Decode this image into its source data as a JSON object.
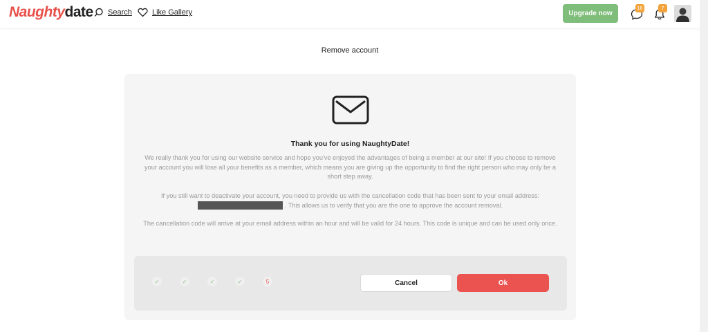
{
  "header": {
    "logo_part1": "Naughty",
    "logo_part2": "date",
    "search_label": "Search",
    "like_gallery_label": "Like Gallery",
    "upgrade_label": "Upgrade now",
    "messages_count": "16",
    "notifications_count": "7"
  },
  "page": {
    "title": "Remove account"
  },
  "card": {
    "title": "Thank you for using NaughtyDate!",
    "paragraph1": "We really thank you for using our website service and hope you've enjoyed the advantages of being a member at our site! If you choose to remove your account you will lose all your benefits as a member, which means you are giving up the opportunity to find the right person who may only be a short step away.",
    "paragraph2_part1": "If you still want to deactivate your account, you need to provide us with the cancellation code that has been sent to your email address:",
    "paragraph2_part2": ". This allows us to verify that you are the one to approve the account removal.",
    "paragraph3": "The cancellation code will arrive at your email address within an hour and will be valid for 24 hours. This code is unique and can be used only once."
  },
  "code_steps": {
    "step1": "✓",
    "step2": "✓",
    "step3": "✓",
    "step4": "✓",
    "step5": "5"
  },
  "actions": {
    "cancel_label": "Cancel",
    "ok_label": "Ok"
  },
  "colors": {
    "accent": "#e8504a",
    "upgrade": "#7fbd7a",
    "badge": "#f2a33a"
  }
}
